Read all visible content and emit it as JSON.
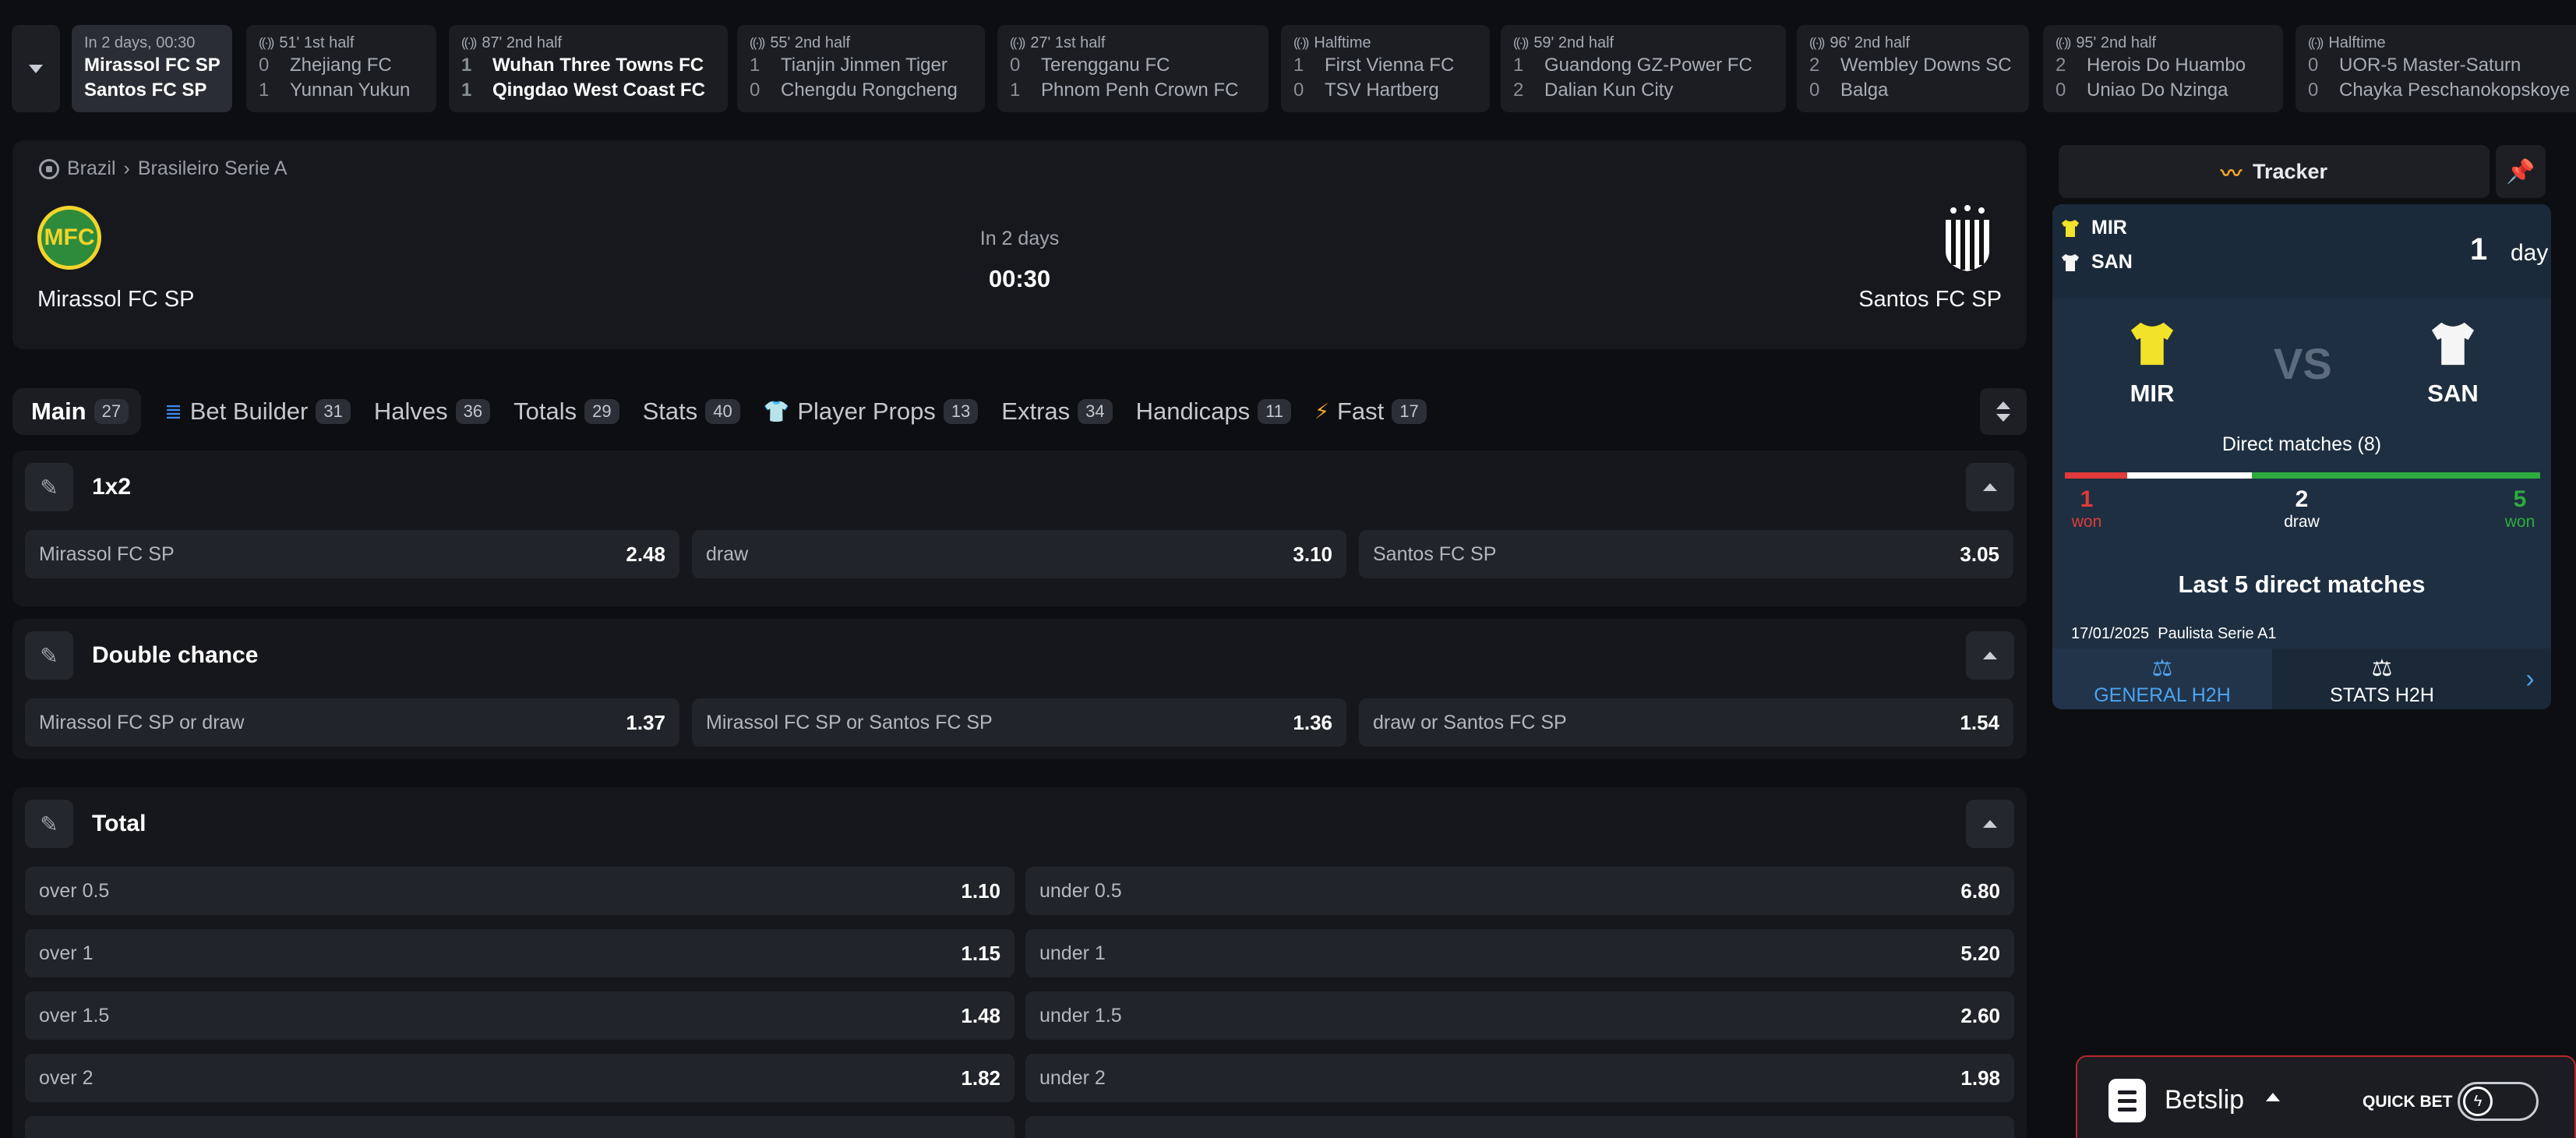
{
  "strip": {
    "cards": [
      {
        "status": "In 2 days, 00:30",
        "live": false,
        "home": "Mirassol FC SP",
        "away": "Santos FC SP",
        "hs": "",
        "as": ""
      },
      {
        "status": "51' 1st half",
        "live": true,
        "home": "Zhejiang FC",
        "away": "Yunnan Yukun",
        "hs": "0",
        "as": "1"
      },
      {
        "status": "87' 2nd half",
        "live": true,
        "home": "Wuhan Three Towns FC",
        "away": "Qingdao West Coast FC",
        "hs": "1",
        "as": "1"
      },
      {
        "status": "55' 2nd half",
        "live": true,
        "home": "Tianjin Jinmen Tiger",
        "away": "Chengdu Rongcheng",
        "hs": "1",
        "as": "0"
      },
      {
        "status": "27' 1st half",
        "live": true,
        "home": "Terengganu FC",
        "away": "Phnom Penh Crown FC",
        "hs": "0",
        "as": "1"
      },
      {
        "status": "Halftime",
        "live": true,
        "home": "First Vienna FC",
        "away": "TSV Hartberg",
        "hs": "1",
        "as": "0"
      },
      {
        "status": "59' 2nd half",
        "live": true,
        "home": "Guandong GZ-Power FC",
        "away": "Dalian Kun City",
        "hs": "1",
        "as": "2"
      },
      {
        "status": "96' 2nd half",
        "live": true,
        "home": "Wembley Downs SC",
        "away": "Balga",
        "hs": "2",
        "as": "0"
      },
      {
        "status": "95' 2nd half",
        "live": true,
        "home": "Herois Do Huambo",
        "away": "Uniao Do Nzinga",
        "hs": "2",
        "as": "0"
      },
      {
        "status": "Halftime",
        "live": true,
        "home": "UOR-5 Master-Saturn",
        "away": "Chayka Peschanokopskoye",
        "hs": "0",
        "as": "0"
      }
    ]
  },
  "event": {
    "breadcrumb_country": "Brazil",
    "breadcrumb_sep": "›",
    "breadcrumb_league": "Brasileiro Serie A",
    "home_logo_text": "MFC",
    "home": "Mirassol FC SP",
    "away": "Santos FC SP",
    "when": "In 2 days",
    "time": "00:30"
  },
  "tabs": [
    {
      "label": "Main",
      "count": "27",
      "icon": ""
    },
    {
      "label": "Bet Builder",
      "count": "31",
      "icon": "bet-builder-icon"
    },
    {
      "label": "Halves",
      "count": "36",
      "icon": ""
    },
    {
      "label": "Totals",
      "count": "29",
      "icon": ""
    },
    {
      "label": "Stats",
      "count": "40",
      "icon": ""
    },
    {
      "label": "Player Props",
      "count": "13",
      "icon": "shirt-icon"
    },
    {
      "label": "Extras",
      "count": "34",
      "icon": ""
    },
    {
      "label": "Handicaps",
      "count": "11",
      "icon": ""
    },
    {
      "label": "Fast",
      "count": "17",
      "icon": "bolt-icon"
    }
  ],
  "markets": {
    "m1x2": {
      "title": "1x2",
      "odds": [
        [
          "Mirassol FC SP",
          "2.48"
        ],
        [
          "draw",
          "3.10"
        ],
        [
          "Santos FC SP",
          "3.05"
        ]
      ]
    },
    "double": {
      "title": "Double chance",
      "odds": [
        [
          "Mirassol FC SP or draw",
          "1.37"
        ],
        [
          "Mirassol FC SP or Santos FC SP",
          "1.36"
        ],
        [
          "draw or Santos FC SP",
          "1.54"
        ]
      ]
    },
    "total": {
      "title": "Total",
      "rows": [
        [
          [
            "over 0.5",
            "1.10"
          ],
          [
            "under 0.5",
            "6.80"
          ]
        ],
        [
          [
            "over 1",
            "1.15"
          ],
          [
            "under 1",
            "5.20"
          ]
        ],
        [
          [
            "over 1.5",
            "1.48"
          ],
          [
            "under 1.5",
            "2.60"
          ]
        ],
        [
          [
            "over 2",
            "1.82"
          ],
          [
            "under 2",
            "1.98"
          ]
        ]
      ]
    }
  },
  "tracker": {
    "title": "Tracker",
    "home_abbr": "MIR",
    "away_abbr": "SAN",
    "countdown_num": "1",
    "countdown_unit": "day",
    "vs": "VS",
    "direct_matches": "Direct matches (8)",
    "home_won": "1",
    "home_won_label": "won",
    "draw": "2",
    "draw_label": "draw",
    "away_won": "5",
    "away_won_label": "won",
    "last5": "Last 5 direct matches",
    "h2h_date": "17/01/2025",
    "h2h_comp": "Paulista Serie A1",
    "tab_general": "GENERAL H2H",
    "tab_stats": "STATS H2H",
    "colors": {
      "home": "#f2e22a",
      "away": "#f5f5f5",
      "home_bar": "#e13a3a",
      "draw_bar": "#ffffff",
      "away_bar": "#2eab3f"
    }
  },
  "betslip": {
    "title": "Betslip",
    "quick_bet": "QUICK BET"
  }
}
